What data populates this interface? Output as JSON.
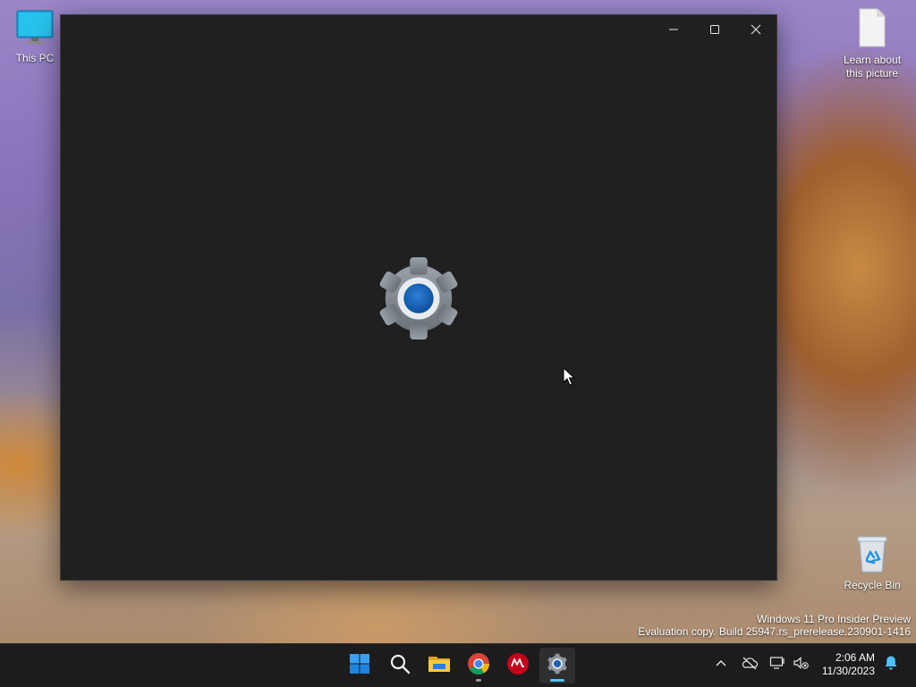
{
  "desktop": {
    "icons": [
      {
        "label": "This PC",
        "icon": "monitor-icon"
      },
      {
        "label": "Learn about this picture",
        "icon": "document-icon"
      },
      {
        "label": "Recycle Bin",
        "icon": "recycle-bin-icon"
      }
    ],
    "watermark": {
      "line1": "Windows 11 Pro Insider Preview",
      "line2": "Evaluation copy. Build 25947.rs_prerelease.230901-1416"
    }
  },
  "window": {
    "app": "Settings",
    "splash_icon": "settings-gear-icon",
    "controls": [
      "minimize",
      "maximize",
      "close"
    ],
    "background": "#202020"
  },
  "taskbar": {
    "apps": [
      {
        "name": "Start",
        "icon": "windows-start-icon"
      },
      {
        "name": "Search",
        "icon": "search-icon"
      },
      {
        "name": "File Explorer",
        "icon": "folder-icon"
      },
      {
        "name": "Google Chrome",
        "icon": "chrome-icon",
        "running": true
      },
      {
        "name": "McAfee",
        "icon": "mcafee-icon"
      },
      {
        "name": "Settings",
        "icon": "settings-gear-icon",
        "running": true,
        "active": true
      }
    ],
    "tray": {
      "icons": [
        "chevron-up-icon",
        "cloud-offline-icon",
        "display-icon",
        "speaker-muted-icon",
        "notification-bell-icon"
      ],
      "time": "2:06 AM",
      "date": "11/30/2023"
    },
    "accent": "#4cc2ff"
  }
}
